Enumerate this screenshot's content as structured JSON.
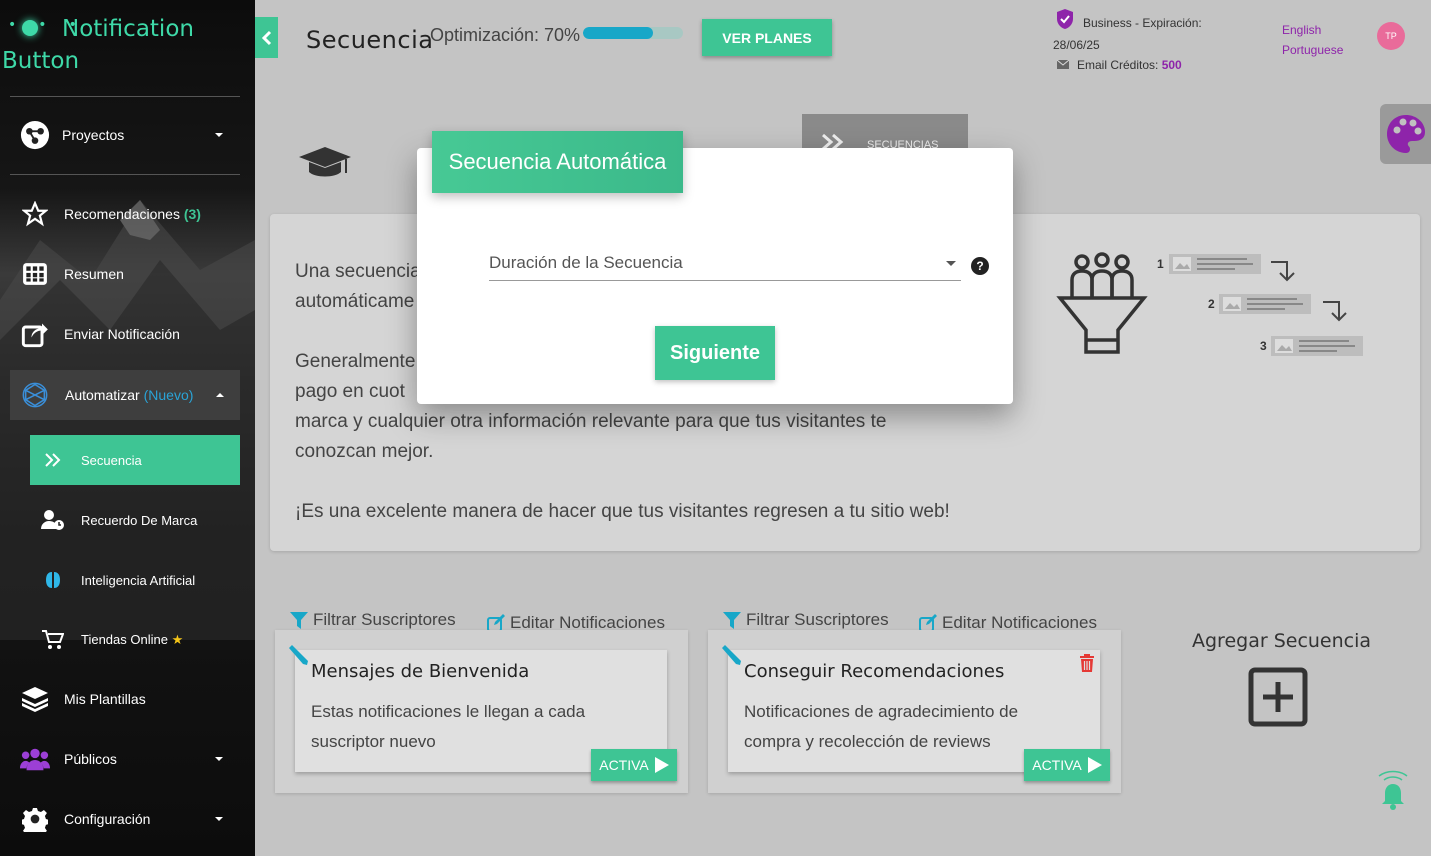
{
  "brand": {
    "line1": "Notification",
    "line2": "Button"
  },
  "sidebar": {
    "proyectos": "Proyectos",
    "recomendaciones": "Recomendaciones",
    "recomendaciones_count": "(3)",
    "resumen": "Resumen",
    "enviar": "Enviar Notificación",
    "automatizar": "Automatizar",
    "automatizar_badge": "(Nuevo)",
    "secuencia": "Secuencia",
    "recuerdo": "Recuerdo De Marca",
    "ia": "Inteligencia Artificial",
    "tiendas": "Tiendas Online",
    "plantillas": "Mis Plantillas",
    "publicos": "Públicos",
    "configuracion": "Configuración"
  },
  "header": {
    "title": "Secuencia",
    "optimizacion_label": "Optimización: 70%",
    "optimizacion_value": 0.7,
    "ver_planes": "VER PLANES",
    "plan": "Business - Expiración:",
    "expiry": "28/06/25",
    "email_credits_label": "Email Créditos:",
    "email_credits_value": "500",
    "lang_english": "English",
    "lang_portuguese": "Portuguese",
    "avatar": "TP"
  },
  "tab_secuencias": "SECUENCIAS",
  "info": {
    "p1a": "Una secuencia",
    "p1b": "automáticame",
    "p2a": "Generalmente",
    "p2b": "pago en cuot",
    "p2c": "marca y cualquier otra información relevante para que tus visitantes te",
    "p2d": "conozcan mejor.",
    "p3": "¡Es una excelente manera de hacer que tus visitantes regresen a tu sitio web!",
    "steps": [
      "1",
      "2",
      "3"
    ]
  },
  "cards": [
    {
      "filter": "Filtrar Suscriptores",
      "edit": "Editar Notificaciones",
      "title": "Mensajes de Bienvenida",
      "desc": "Estas notificaciones le llegan a cada suscriptor nuevo",
      "status": "ACTIVA"
    },
    {
      "filter": "Filtrar Suscriptores",
      "edit": "Editar Notificaciones",
      "title": "Conseguir Recomendaciones",
      "desc": "Notificaciones de agradecimiento de compra y recolección de reviews",
      "status": "ACTIVA"
    }
  ],
  "add_sequence": "Agregar Secuencia",
  "modal": {
    "title": "Secuencia Automática",
    "select_placeholder": "Duración de la Secuencia",
    "help": "?",
    "next": "Siguiente"
  },
  "colors": {
    "accent": "#3ec594",
    "purple": "#8e24aa",
    "progress": "#18a7c8"
  },
  "icons": [
    "graduation-cap-icon",
    "funnel-people-icon",
    "palette-icon",
    "bell-icon",
    "trash-icon",
    "pencil-icon",
    "filter-icon",
    "edit-icon",
    "plus-square-icon"
  ]
}
